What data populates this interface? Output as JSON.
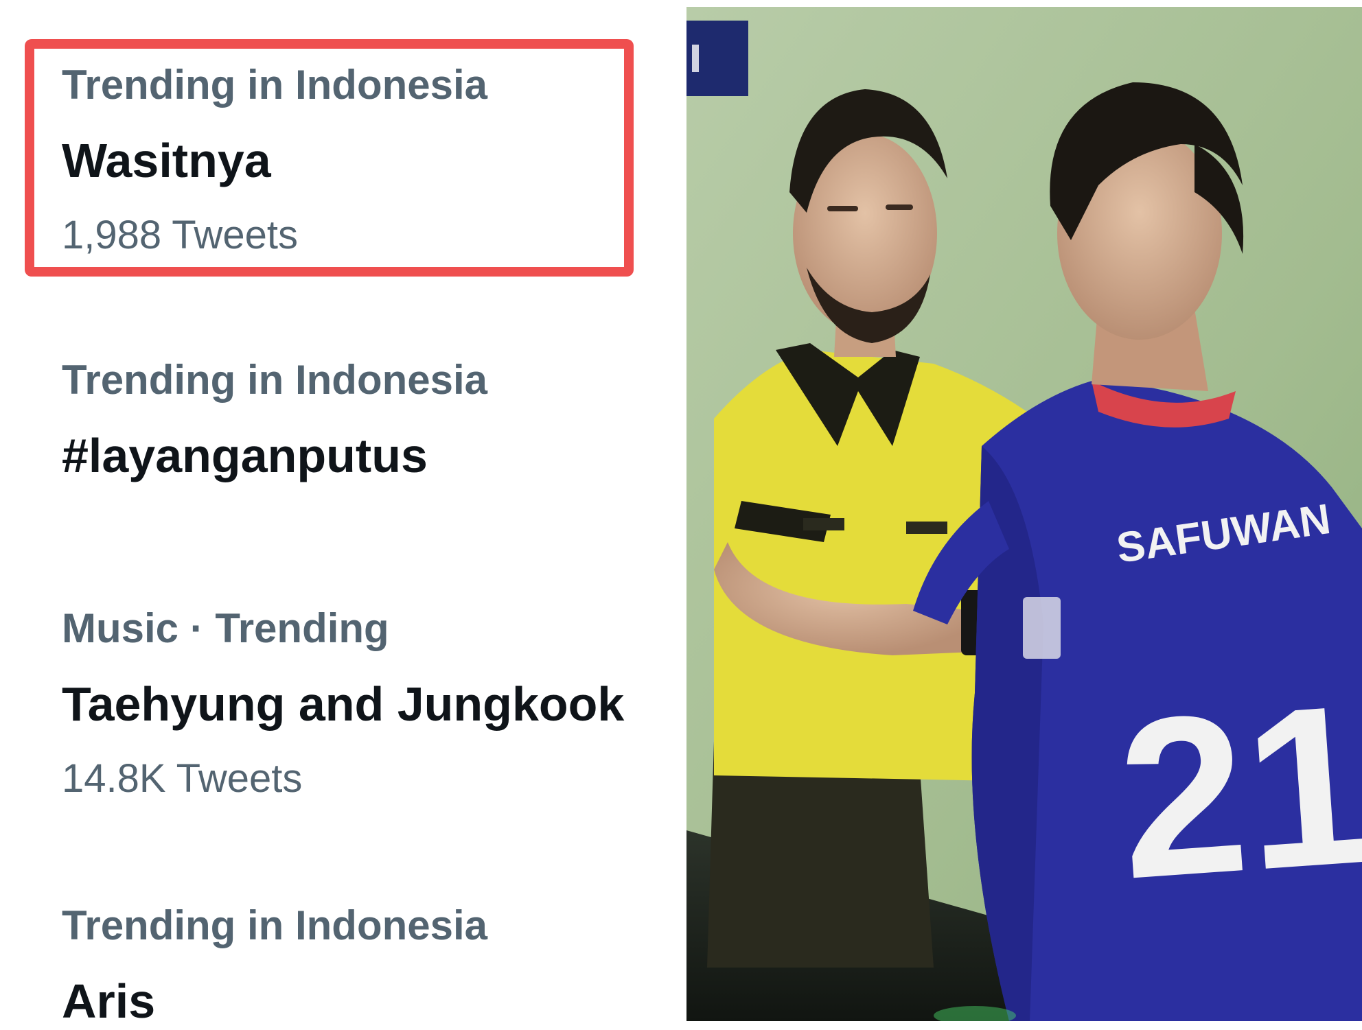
{
  "trends": [
    {
      "context": "Trending in Indonesia",
      "topic": "Wasitnya",
      "count": "1,988 Tweets"
    },
    {
      "context": "Trending in Indonesia",
      "topic": "#layanganputus",
      "count": ""
    },
    {
      "context": "Music · Trending",
      "topic": "Taehyung and Jungkook",
      "count": "14.8K Tweets"
    },
    {
      "context": "Trending in Indonesia",
      "topic": "Aris",
      "count": ""
    }
  ],
  "highlight": {
    "color": "#ef4f4f",
    "trend_index": 0
  },
  "photo": {
    "jersey_name": "SAFUWAN",
    "jersey_number": "21",
    "colors": {
      "referee_shirt": "#e4dc3a",
      "player_jersey": "#2b2fa0",
      "wall": "#a8c196"
    }
  }
}
